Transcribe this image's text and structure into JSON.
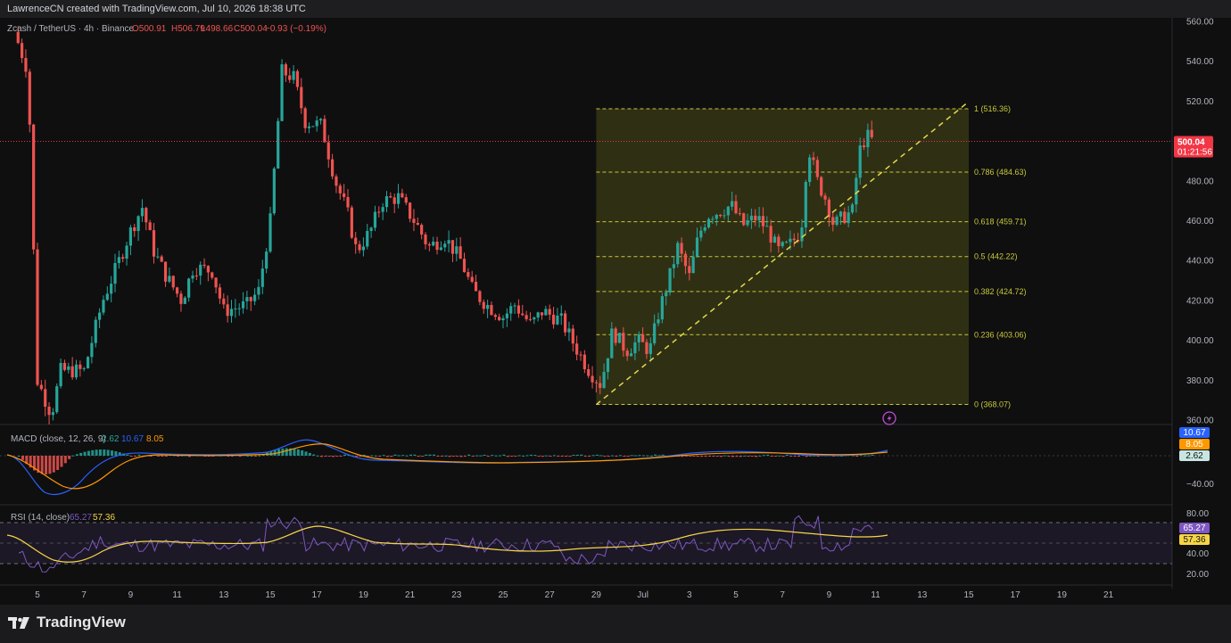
{
  "header": {
    "attribution": "LawrenceCN created with TradingView.com, Jul 10, 2026 18:38 UTC"
  },
  "legend": {
    "symbol": "Zcash / TetherUS · 4h · Binance",
    "o": "O500.91",
    "h": "H506.79",
    "l": "L498.66",
    "c": "C500.04",
    "change": "−0.93 (−0.19%)"
  },
  "price_badge": {
    "price": "500.04",
    "countdown": "01:21:56"
  },
  "macd": {
    "label": "MACD (close, 12, 26, 9)",
    "hist_value": "2.62",
    "macd_value": "10.67",
    "signal_value": "8.05",
    "axis_tick": "−40.00"
  },
  "rsi": {
    "label": "RSI (14, close)",
    "rsi_value": "65.27",
    "ma_value": "57.36",
    "axis_ticks": [
      "80.00",
      "60.00",
      "40.00",
      "20.00"
    ]
  },
  "colors": {
    "up": "#26a69a",
    "down": "#ef5350",
    "fib": "#c8c83a",
    "fib_fill": "#3b3b16",
    "macd_line": "#2962ff",
    "signal_line": "#ff9800",
    "rsi_line": "#7e57c2",
    "rsi_ma": "#f5d547",
    "badge": "#f23645"
  },
  "footer": {
    "logo_icon": "tradingview-logo-icon",
    "brand": "TradingView"
  },
  "chart_data": {
    "type": "candlestick",
    "title": "Zcash / TetherUS · 4h · Binance",
    "y_ticks": [
      "560.00",
      "540.00",
      "520.00",
      "500.00",
      "480.00",
      "460.00",
      "440.00",
      "420.00",
      "400.00",
      "380.00",
      "360.00"
    ],
    "x_ticks": [
      "5",
      "7",
      "9",
      "11",
      "13",
      "15",
      "17",
      "19",
      "21",
      "23",
      "25",
      "27",
      "29",
      "Jul",
      "3",
      "5",
      "7",
      "9",
      "11",
      "13",
      "15",
      "17",
      "19",
      "21"
    ],
    "ylim": [
      358,
      562
    ],
    "price_path": [
      [
        "Jun 4",
        555
      ],
      [
        "Jun 4.6",
        535
      ],
      [
        "Jun 5",
        380
      ],
      [
        "Jun 5.6",
        363
      ],
      [
        "Jun 6",
        385
      ],
      [
        "Jun 7",
        385
      ],
      [
        "Jun 7.8",
        420
      ],
      [
        "Jun 8.5",
        440
      ],
      [
        "Jun 9",
        455
      ],
      [
        "Jun 9.5",
        467
      ],
      [
        "Jun 10",
        445
      ],
      [
        "Jun 10.5",
        433
      ],
      [
        "Jun 11.2",
        420
      ],
      [
        "Jun 11.7",
        437
      ],
      [
        "Jun 12.5",
        435
      ],
      [
        "Jun 13",
        415
      ],
      [
        "Jun 14",
        418
      ],
      [
        "Jun 14.5",
        425
      ],
      [
        "Jun 15",
        460
      ],
      [
        "Jun 15.5",
        535
      ],
      [
        "Jun 16",
        532
      ],
      [
        "Jun 16.5",
        510
      ],
      [
        "Jun 17.2",
        508
      ],
      [
        "Jun 17.8",
        480
      ],
      [
        "Jun 18.3",
        465
      ],
      [
        "Jun 18.7",
        445
      ],
      [
        "Jun 19.3",
        455
      ],
      [
        "Jun 19.8",
        470
      ],
      [
        "Jun 20.5",
        472
      ],
      [
        "Jun 21.3",
        458
      ],
      [
        "Jun 21.8",
        447
      ],
      [
        "Jun 22.5",
        452
      ],
      [
        "Jun 23.2",
        440
      ],
      [
        "Jun 23.7",
        425
      ],
      [
        "Jun 24.3",
        418
      ],
      [
        "Jun 25",
        412
      ],
      [
        "Jun 25.5",
        418
      ],
      [
        "Jun 26.2",
        408
      ],
      [
        "Jun 26.7",
        415
      ],
      [
        "Jun 27.5",
        410
      ],
      [
        "Jun 28.2",
        395
      ],
      [
        "Jun 28.7",
        385
      ],
      [
        "Jun 29.2",
        378
      ],
      [
        "Jun 29.7",
        405
      ],
      [
        "Jun 30.3",
        395
      ],
      [
        "Jun 30.8",
        400
      ],
      [
        "Jul 1.3",
        395
      ],
      [
        "Jul 1.7",
        415
      ],
      [
        "Jul 2.1",
        430
      ],
      [
        "Jul 2.5",
        447
      ],
      [
        "Jul 3",
        432
      ],
      [
        "Jul 3.4",
        453
      ],
      [
        "Jul 3.8",
        463
      ],
      [
        "Jul 4.3",
        465
      ],
      [
        "Jul 4.8",
        468
      ],
      [
        "Jul 5.3",
        458
      ],
      [
        "Jul 5.9",
        462
      ],
      [
        "Jul 6.4",
        455
      ],
      [
        "Jul 6.8",
        445
      ],
      [
        "Jul 7.3",
        448
      ],
      [
        "Jul 7.8",
        455
      ],
      [
        "Jul 8.1",
        498
      ],
      [
        "Jul 8.5",
        480
      ],
      [
        "Jul 8.9",
        470
      ],
      [
        "Jul 9.2",
        458
      ],
      [
        "Jul 9.6",
        462
      ],
      [
        "Jul 10",
        465
      ],
      [
        "Jul 10.3",
        495
      ],
      [
        "Jul 10.6",
        503
      ],
      [
        "Jul 10.9",
        500
      ]
    ],
    "fibonacci": {
      "low": 368.07,
      "high": 516.36,
      "levels": [
        {
          "label": "1 (516.36)",
          "value": 516.36
        },
        {
          "label": "0.786 (484.63)",
          "value": 484.63
        },
        {
          "label": "0.618 (459.71)",
          "value": 459.71
        },
        {
          "label": "0.5 (442.22)",
          "value": 442.22
        },
        {
          "label": "0.382 (424.72)",
          "value": 424.72
        },
        {
          "label": "0.236 (403.06)",
          "value": 403.06
        },
        {
          "label": "0 (368.07)",
          "value": 368.07
        }
      ]
    },
    "trendline": {
      "from": [
        "Jun 29",
        368
      ],
      "to": [
        "Jul 15",
        520
      ],
      "style": "dashed"
    },
    "current_price": 500.04,
    "grid": false
  }
}
